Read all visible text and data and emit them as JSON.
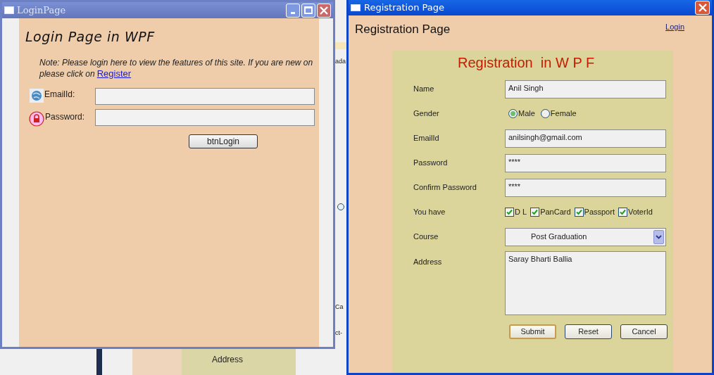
{
  "background_window": {
    "fragments": [
      {
        "kind": "text",
        "text": "ada"
      },
      {
        "kind": "text",
        "text": "Ca"
      },
      {
        "kind": "text",
        "text": "ct-"
      }
    ],
    "address_label": "Address"
  },
  "login_window": {
    "title": "LoginPage",
    "heading": "Login Page in WPF",
    "note_line1": "Note: Please login here to view the features of this site. If you are new on",
    "note_line2": "please click on",
    "register_link": "Register",
    "fields": [
      {
        "kind": "email",
        "label": "EmailId:"
      },
      {
        "kind": "password",
        "label": "Password:"
      }
    ],
    "button": "btnLogin"
  },
  "registration_window": {
    "title": "Registration Page",
    "heading": "Registration Page",
    "login_link": "Login",
    "form_title": "Registration  in W P F",
    "rows": [
      {
        "kind": "text",
        "label": "Name",
        "value": "Anil Singh"
      },
      {
        "kind": "radio",
        "label": "Gender",
        "options": [
          {
            "label": "Male",
            "selected": true
          },
          {
            "label": "Female",
            "selected": false
          }
        ]
      },
      {
        "kind": "text",
        "label": "EmailId",
        "value": "anilsingh@gmail.com"
      },
      {
        "kind": "text",
        "label": "Password",
        "value": "****"
      },
      {
        "kind": "text",
        "label": "Confirm Password",
        "value": "****"
      },
      {
        "kind": "checkboxes",
        "label": "You have",
        "options": [
          {
            "label": "D L",
            "checked": true
          },
          {
            "label": "PanCard",
            "checked": true
          },
          {
            "label": "Passport",
            "checked": true
          },
          {
            "label": "VoterId",
            "checked": true
          }
        ]
      },
      {
        "kind": "select",
        "label": "Course",
        "value": "Post Graduation"
      },
      {
        "kind": "textarea",
        "label": "Address",
        "value": "Saray Bharti Ballia"
      }
    ],
    "buttons": [
      {
        "label": "Submit",
        "focused": true
      },
      {
        "label": "Reset",
        "focused": false
      },
      {
        "label": "Cancel",
        "focused": false
      }
    ]
  }
}
